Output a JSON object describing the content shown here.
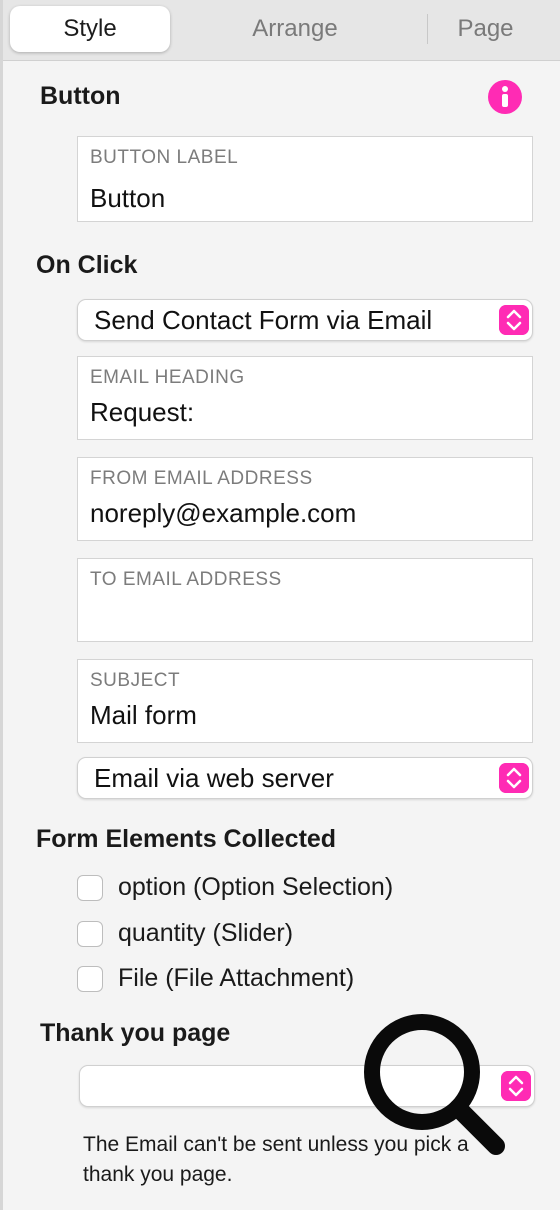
{
  "tabs": {
    "style": "Style",
    "arrange": "Arrange",
    "page": "Page",
    "active": "Style"
  },
  "button_section": {
    "title": "Button",
    "info_icon": "info-icon",
    "label_field": {
      "label": "BUTTON LABEL",
      "value": "Button"
    }
  },
  "on_click": {
    "title": "On Click",
    "action_select": "Send Contact Form via Email",
    "email_heading": {
      "label": "EMAIL HEADING",
      "value": "Request:"
    },
    "from_email": {
      "label": "FROM EMAIL ADDRESS",
      "value": "noreply@example.com"
    },
    "to_email": {
      "label": "TO EMAIL ADDRESS",
      "value": ""
    },
    "subject": {
      "label": "SUBJECT",
      "value": "Mail form"
    },
    "delivery_select": "Email via web server"
  },
  "form_elements": {
    "title": "Form Elements Collected",
    "items": [
      {
        "label": "option (Option Selection)",
        "checked": false
      },
      {
        "label": "quantity (Slider)",
        "checked": false
      },
      {
        "label": "File (File Attachment)",
        "checked": false
      }
    ]
  },
  "thank_you": {
    "title": "Thank you page",
    "select_value": "",
    "note": "The Email can't be sent unless you pick a thank you page."
  },
  "colors": {
    "accent": "#ff2bb4",
    "panel_bg": "#f4f4f4"
  },
  "overlay_icon": "magnifier-icon"
}
